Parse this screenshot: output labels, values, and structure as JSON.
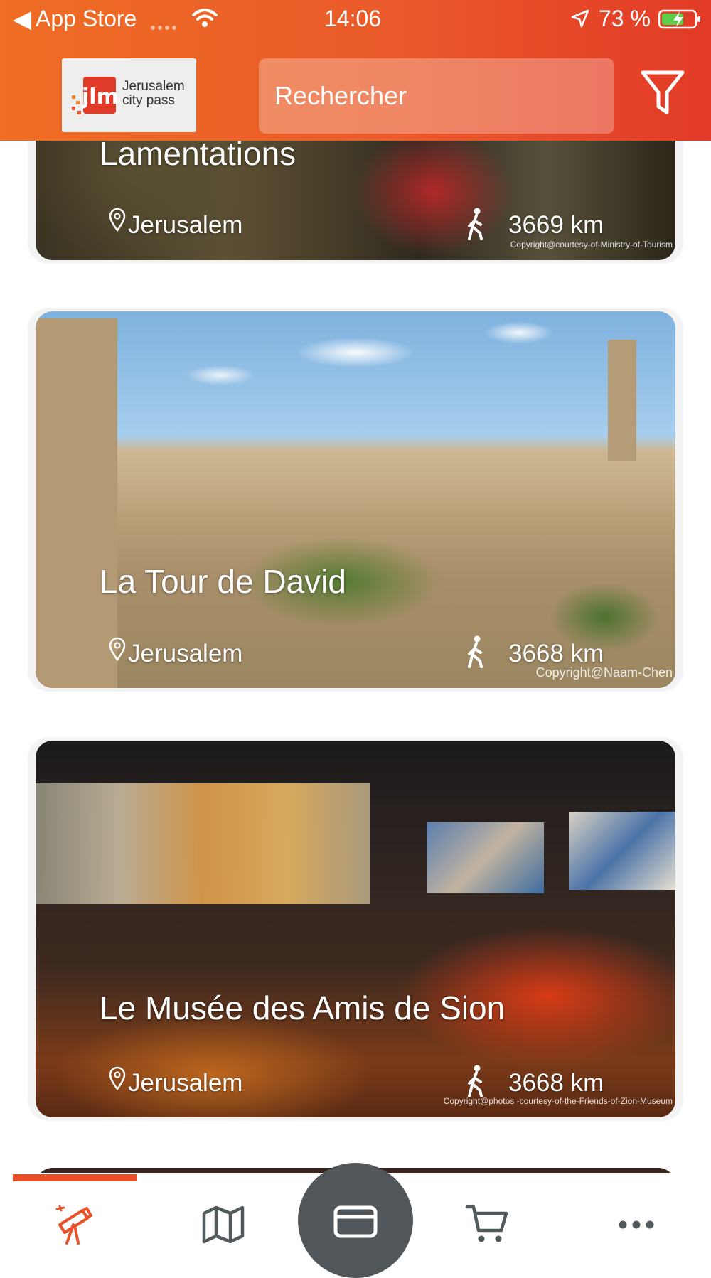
{
  "status_bar": {
    "back_label": "App Store",
    "time": "14:06",
    "battery": "73 %"
  },
  "header": {
    "logo_line1": "Jerusalem",
    "logo_line2": "city pass",
    "search_placeholder": "Rechercher"
  },
  "colors": {
    "accent": "#e8502a",
    "header_start": "#ef6d24",
    "header_end": "#e23a27",
    "center_button": "#505659"
  },
  "cards": [
    {
      "title": "Lamentations",
      "city": "Jerusalem",
      "distance": "3669 km",
      "copyright": "Copyright@courtesy-of-Ministry-of-Tourism"
    },
    {
      "title": "La Tour de David",
      "city": "Jerusalem",
      "distance": "3668 km",
      "copyright": "Copyright@Naam-Chen"
    },
    {
      "title": "Le Musée des Amis de Sion",
      "city": "Jerusalem",
      "distance": "3668 km",
      "copyright": "Copyright@photos -courtesy-of-the-Friends-of-Zion-Museum"
    }
  ],
  "bottom_nav": [
    {
      "icon": "telescope-icon",
      "active": true
    },
    {
      "icon": "map-icon",
      "active": false
    },
    {
      "icon": "card-icon",
      "active": false,
      "center": true
    },
    {
      "icon": "cart-icon",
      "active": false
    },
    {
      "icon": "more-icon",
      "active": false
    }
  ]
}
